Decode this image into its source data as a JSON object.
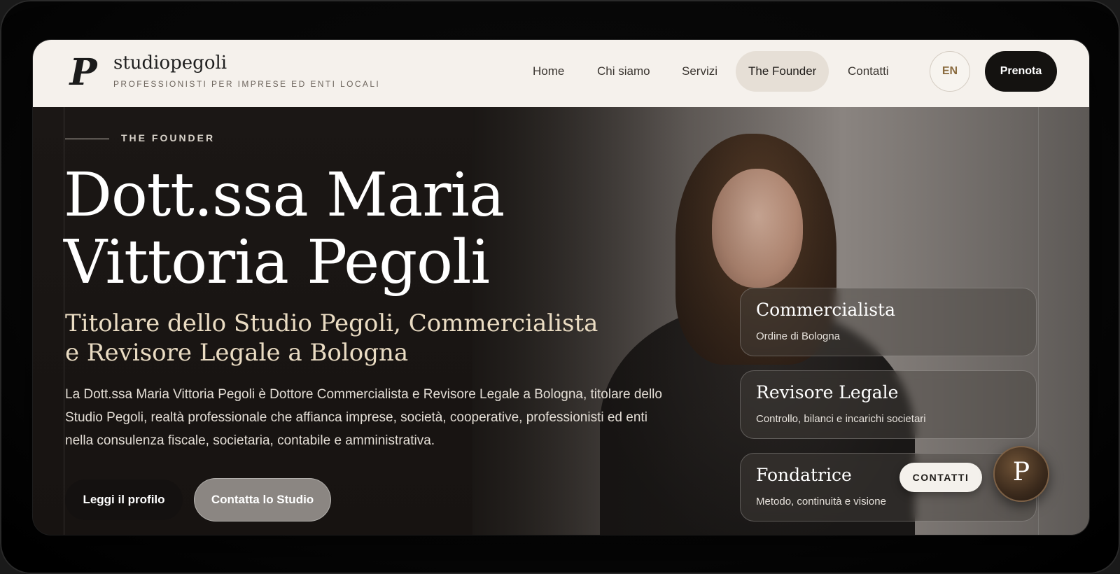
{
  "brand": {
    "logo_letter": "P",
    "name": "studiopegoli",
    "tagline": "PROFESSIONISTI PER IMPRESE ED ENTI LOCALI"
  },
  "nav": {
    "items": [
      {
        "label": "Home",
        "active": false
      },
      {
        "label": "Chi siamo",
        "active": false
      },
      {
        "label": "Servizi",
        "active": false
      },
      {
        "label": "The Founder",
        "active": true
      },
      {
        "label": "Contatti",
        "active": false
      }
    ],
    "language": "EN",
    "cta": "Prenota"
  },
  "hero": {
    "eyebrow": "THE FOUNDER",
    "title": "Dott.ssa Maria Vittoria Pegoli",
    "subtitle": "Titolare dello Studio Pegoli, Commercialista e Revisore Legale a Bologna",
    "description": "La Dott.ssa Maria Vittoria Pegoli è Dottore Commercialista e Revisore Legale a Bologna, titolare dello Studio Pegoli, realtà professionale che affianca imprese, società, cooperative, professionisti ed enti nella consulenza fiscale, societaria, contabile e amministrativa.",
    "primary_button": "Leggi il profilo",
    "secondary_button": "Contatta lo Studio"
  },
  "cards": [
    {
      "title": "Commercialista",
      "subtitle": "Ordine di Bologna"
    },
    {
      "title": "Revisore Legale",
      "subtitle": "Controllo, bilanci e incarichi societari"
    },
    {
      "title": "Fondatrice",
      "subtitle": "Metodo, continuità e visione"
    }
  ],
  "floating": {
    "contact_label": "CONTATTI",
    "avatar_letter": "P"
  },
  "colors": {
    "header_bg": "#f5f1ec",
    "accent_gold": "#8a6b3f",
    "dark": "#141210",
    "subtitle": "#eadcc3"
  }
}
